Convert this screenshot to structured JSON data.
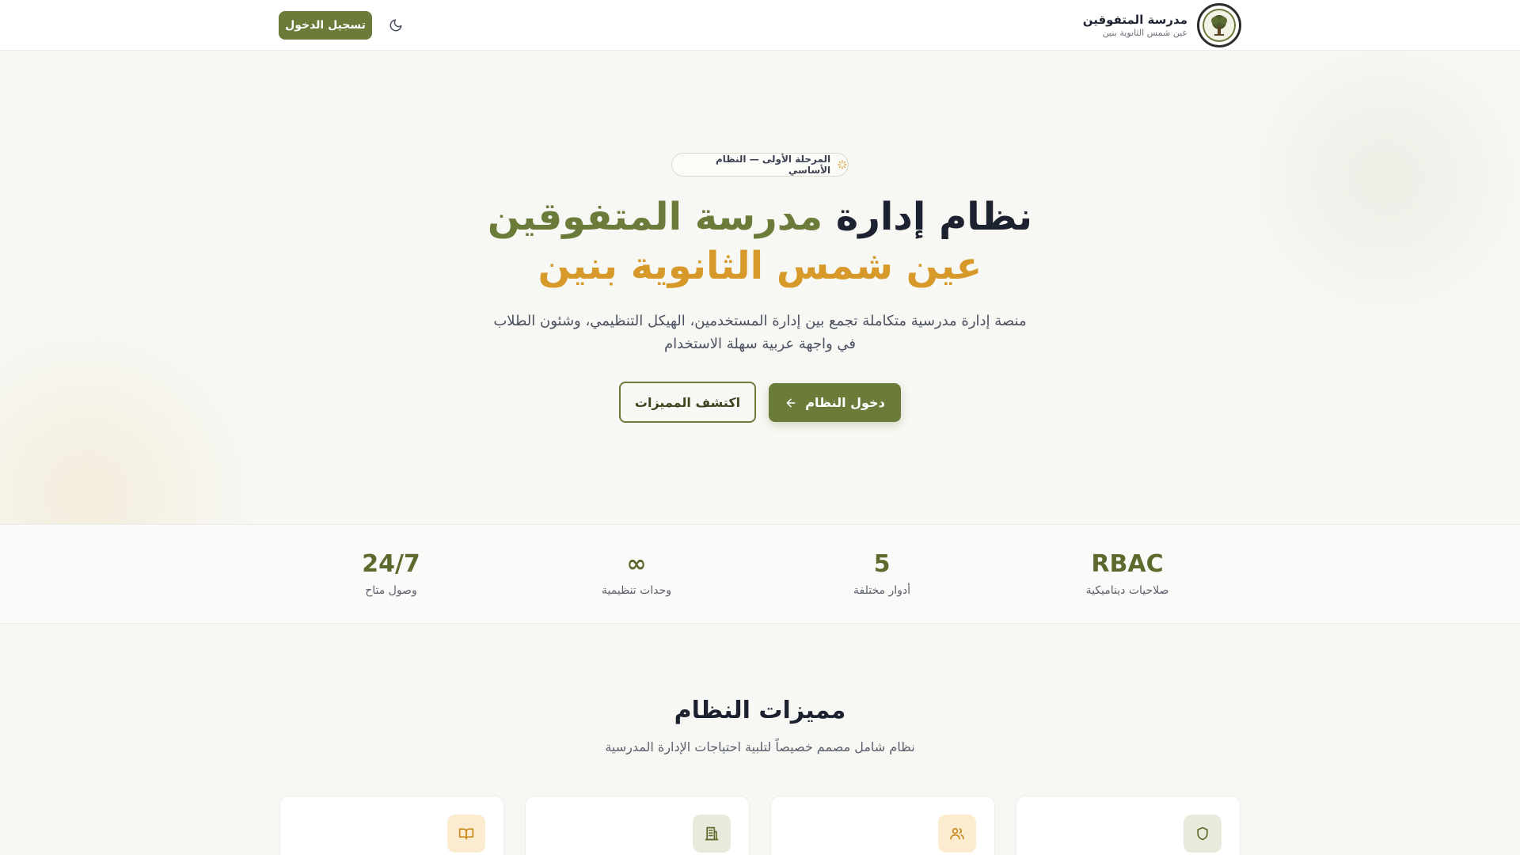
{
  "header": {
    "brand_title": "مدرسة المتفوقين",
    "brand_subtitle": "عين شمس الثانوية بنين",
    "login_label": "تسجيل الدخول",
    "theme_icon": "moon-icon"
  },
  "hero": {
    "badge": "المرحلة الأولى — النظام الأساسي",
    "title_part1": "نظام إدارة",
    "title_accent": "مدرسة المتفوقين",
    "title_line2": "عين شمس الثانوية بنين",
    "description_line1": "منصة إدارة مدرسية متكاملة تجمع بين إدارة المستخدمين، الهيكل التنظيمي، وشئون الطلاب",
    "description_line2": "في واجهة عربية سهلة الاستخدام",
    "primary_button": "دخول النظام",
    "secondary_button": "اكتشف المميزات"
  },
  "stats": [
    {
      "value": "RBAC",
      "label": "صلاحيات ديناميكية"
    },
    {
      "value": "5",
      "label": "أدوار مختلفة"
    },
    {
      "value": "∞",
      "label": "وحدات تنظيمية"
    },
    {
      "value": "24/7",
      "label": "وصول متاح"
    }
  ],
  "features": {
    "title": "مميزات النظام",
    "subtitle": "نظام شامل مصمم خصيصاً لتلبية احتياجات الإدارة المدرسية",
    "cards": [
      {
        "icon": "shield-icon"
      },
      {
        "icon": "users-icon"
      },
      {
        "icon": "building-icon"
      },
      {
        "icon": "book-icon"
      }
    ]
  },
  "colors": {
    "primary": "#6b7b3a",
    "gold": "#d6992a",
    "dark": "#1d2230"
  }
}
